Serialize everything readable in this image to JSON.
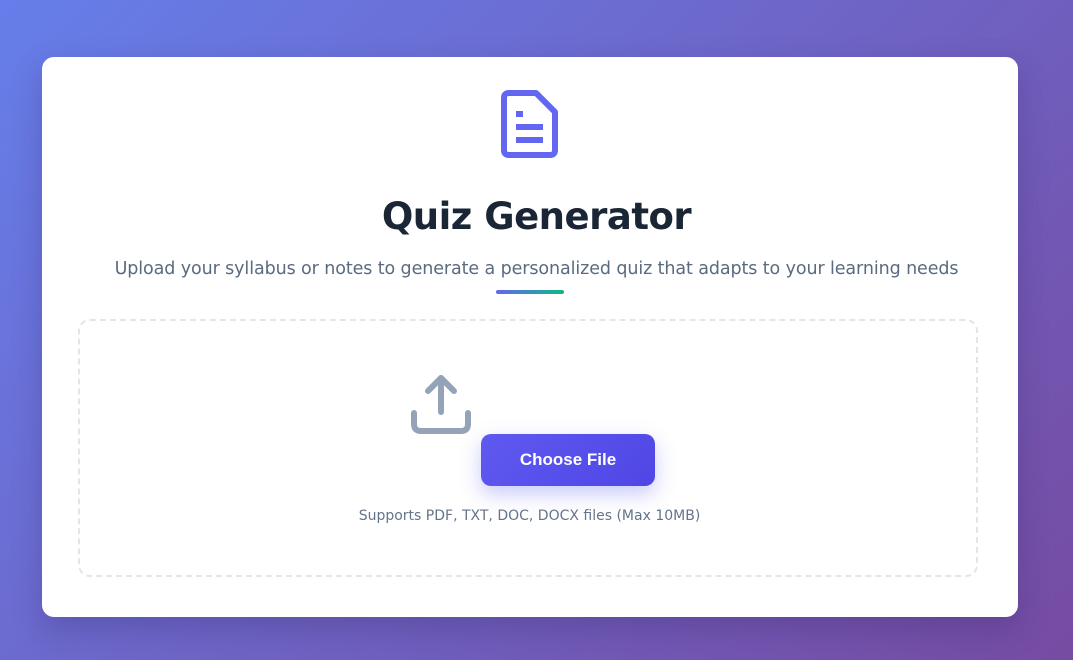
{
  "header": {
    "icon": "document-icon",
    "title": "Quiz Generator",
    "subtitle": "Upload your syllabus or notes to generate a personalized quiz that adapts to your learning needs"
  },
  "upload": {
    "icon": "upload-icon",
    "button_label": "Choose File",
    "support_text": "Supports PDF, TXT, DOC, DOCX files (Max 10MB)"
  },
  "colors": {
    "background_start": "#667eea",
    "background_end": "#764ba2",
    "accent": "#6366f1",
    "accent_secondary": "#10b981",
    "title": "#1a2535",
    "subtitle": "#5a6b80",
    "upload_icon": "#94a3b8"
  }
}
